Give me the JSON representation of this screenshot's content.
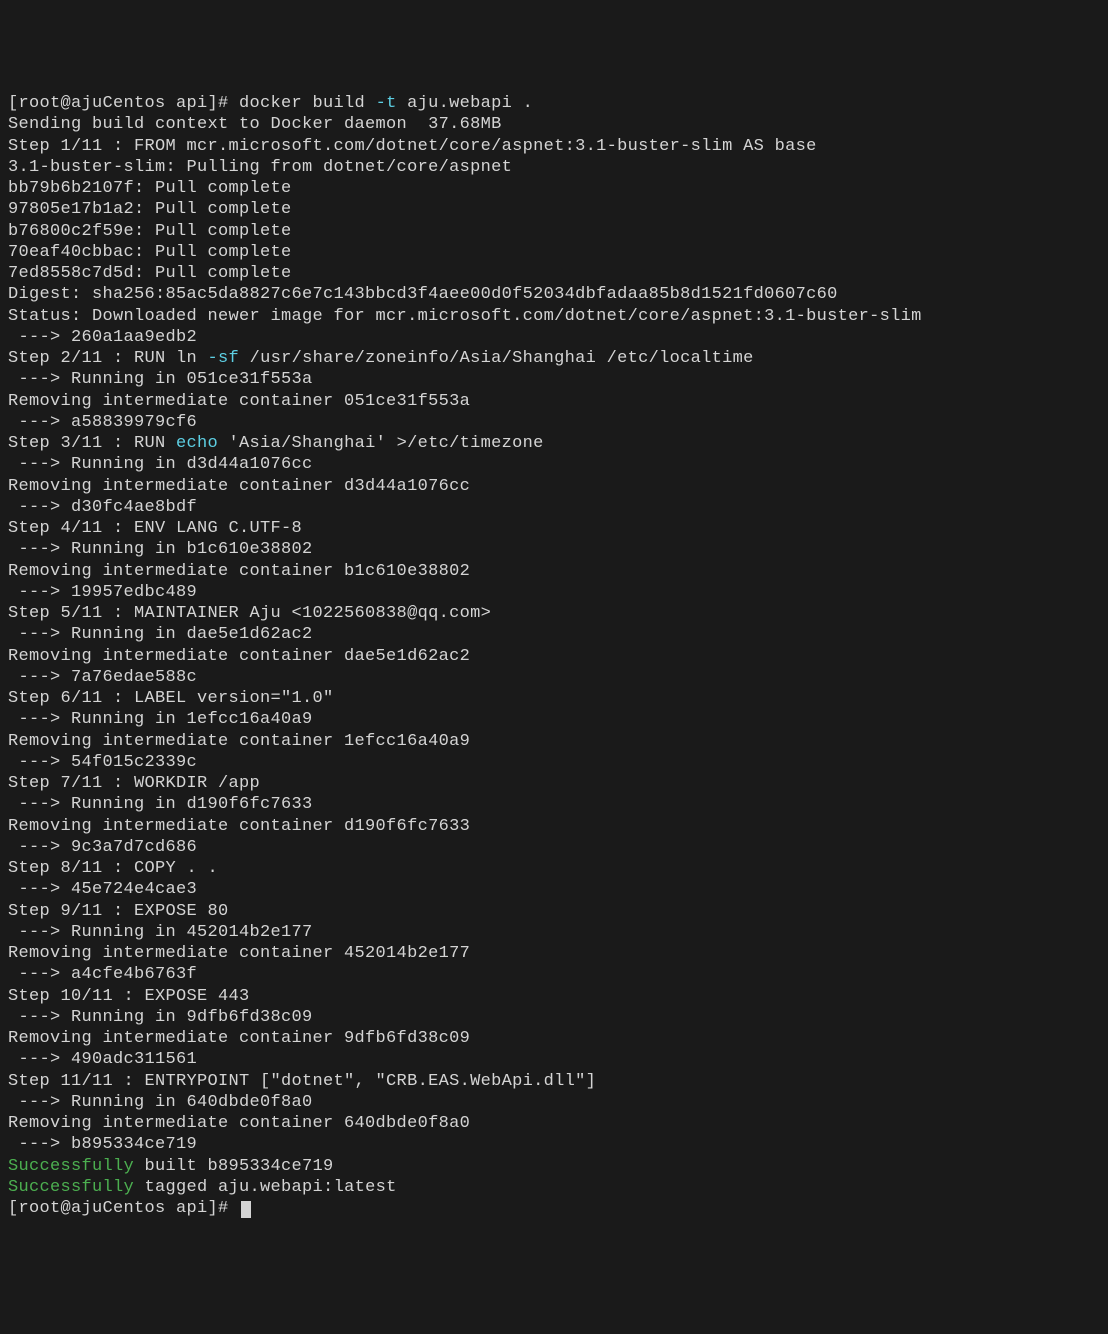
{
  "lines": [
    [
      {
        "t": "[root@ajuCentos api]# docker build "
      },
      {
        "t": "-t",
        "c": "cyan"
      },
      {
        "t": " aju.webapi ."
      }
    ],
    [
      {
        "t": "Sending build context to Docker daemon  37.68MB"
      }
    ],
    [
      {
        "t": "Step 1/11 : FROM mcr.microsoft.com/dotnet/core/aspnet:3.1-buster-slim AS base"
      }
    ],
    [
      {
        "t": "3.1-buster-slim: Pulling from dotnet/core/aspnet"
      }
    ],
    [
      {
        "t": "bb79b6b2107f: Pull complete"
      }
    ],
    [
      {
        "t": "97805e17b1a2: Pull complete"
      }
    ],
    [
      {
        "t": "b76800c2f59e: Pull complete"
      }
    ],
    [
      {
        "t": "70eaf40cbbac: Pull complete"
      }
    ],
    [
      {
        "t": "7ed8558c7d5d: Pull complete"
      }
    ],
    [
      {
        "t": "Digest: sha256:85ac5da8827c6e7c143bbcd3f4aee00d0f52034dbfadaa85b8d1521fd0607c60"
      }
    ],
    [
      {
        "t": "Status: Downloaded newer image for mcr.microsoft.com/dotnet/core/aspnet:3.1-buster-slim"
      }
    ],
    [
      {
        "t": " ---> 260a1aa9edb2"
      }
    ],
    [
      {
        "t": "Step 2/11 : RUN ln "
      },
      {
        "t": "-sf",
        "c": "cyan"
      },
      {
        "t": " /usr/share/zoneinfo/Asia/Shanghai /etc/localtime"
      }
    ],
    [
      {
        "t": " ---> Running in 051ce31f553a"
      }
    ],
    [
      {
        "t": "Removing intermediate container 051ce31f553a"
      }
    ],
    [
      {
        "t": " ---> a58839979cf6"
      }
    ],
    [
      {
        "t": "Step 3/11 : RUN "
      },
      {
        "t": "echo",
        "c": "cyan"
      },
      {
        "t": " 'Asia/Shanghai' >/etc/timezone"
      }
    ],
    [
      {
        "t": " ---> Running in d3d44a1076cc"
      }
    ],
    [
      {
        "t": "Removing intermediate container d3d44a1076cc"
      }
    ],
    [
      {
        "t": " ---> d30fc4ae8bdf"
      }
    ],
    [
      {
        "t": "Step 4/11 : ENV LANG C.UTF-8"
      }
    ],
    [
      {
        "t": " ---> Running in b1c610e38802"
      }
    ],
    [
      {
        "t": "Removing intermediate container b1c610e38802"
      }
    ],
    [
      {
        "t": " ---> 19957edbc489"
      }
    ],
    [
      {
        "t": "Step 5/11 : MAINTAINER Aju <1022560838@qq.com>"
      }
    ],
    [
      {
        "t": " ---> Running in dae5e1d62ac2"
      }
    ],
    [
      {
        "t": "Removing intermediate container dae5e1d62ac2"
      }
    ],
    [
      {
        "t": " ---> 7a76edae588c"
      }
    ],
    [
      {
        "t": "Step 6/11 : LABEL version=\"1.0\""
      }
    ],
    [
      {
        "t": " ---> Running in 1efcc16a40a9"
      }
    ],
    [
      {
        "t": "Removing intermediate container 1efcc16a40a9"
      }
    ],
    [
      {
        "t": " ---> 54f015c2339c"
      }
    ],
    [
      {
        "t": "Step 7/11 : WORKDIR /app"
      }
    ],
    [
      {
        "t": " ---> Running in d190f6fc7633"
      }
    ],
    [
      {
        "t": "Removing intermediate container d190f6fc7633"
      }
    ],
    [
      {
        "t": " ---> 9c3a7d7cd686"
      }
    ],
    [
      {
        "t": "Step 8/11 : COPY . ."
      }
    ],
    [
      {
        "t": " ---> 45e724e4cae3"
      }
    ],
    [
      {
        "t": "Step 9/11 : EXPOSE 80"
      }
    ],
    [
      {
        "t": " ---> Running in 452014b2e177"
      }
    ],
    [
      {
        "t": "Removing intermediate container 452014b2e177"
      }
    ],
    [
      {
        "t": " ---> a4cfe4b6763f"
      }
    ],
    [
      {
        "t": "Step 10/11 : EXPOSE 443"
      }
    ],
    [
      {
        "t": " ---> Running in 9dfb6fd38c09"
      }
    ],
    [
      {
        "t": "Removing intermediate container 9dfb6fd38c09"
      }
    ],
    [
      {
        "t": " ---> 490adc311561"
      }
    ],
    [
      {
        "t": "Step 11/11 : ENTRYPOINT [\"dotnet\", \"CRB.EAS.WebApi.dll\"]"
      }
    ],
    [
      {
        "t": " ---> Running in 640dbde0f8a0"
      }
    ],
    [
      {
        "t": "Removing intermediate container 640dbde0f8a0"
      }
    ],
    [
      {
        "t": " ---> b895334ce719"
      }
    ],
    [
      {
        "t": "Successfully",
        "c": "green"
      },
      {
        "t": " built b895334ce719"
      }
    ],
    [
      {
        "t": "Successfully",
        "c": "green"
      },
      {
        "t": " tagged aju.webapi:latest"
      }
    ],
    [
      {
        "t": "[root@ajuCentos api]# "
      }
    ]
  ]
}
